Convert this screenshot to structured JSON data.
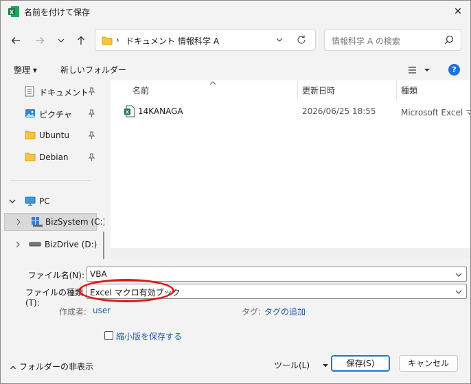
{
  "window": {
    "title": "名前を付けて保存",
    "close_glyph": "✕"
  },
  "address": {
    "crumbs": [
      "ドキュメント",
      "情報科学 A"
    ],
    "separator": "›",
    "search_placeholder": "情報科学 A の検索"
  },
  "toolbar": {
    "organize": "整理 ▾",
    "new_folder": "新しいフォルダー",
    "help": "?"
  },
  "nav": {
    "items": [
      {
        "label": "ドキュメント"
      },
      {
        "label": "ピクチャ"
      },
      {
        "label": "Ubuntu"
      },
      {
        "label": "Debian"
      },
      {
        "label": "PC"
      },
      {
        "label": "BizSystem (C:)"
      },
      {
        "label": "BizDrive (D:)"
      }
    ]
  },
  "columns": {
    "name": "名前",
    "date": "更新日時",
    "type": "種類"
  },
  "files": [
    {
      "name": "14KANAGA",
      "date": "2026/06/25 18:55",
      "type": "Microsoft Excel マ"
    }
  ],
  "form": {
    "filename_label": "ファイル名(N):",
    "filename_value": "VBA",
    "filetype_label": "ファイルの種類(T):",
    "filetype_value": "Excel マクロ有効ブック",
    "author_label": "作成者:",
    "author_value": "user",
    "tags_label": "タグ:",
    "tags_value": "タグの追加",
    "thumbnail_label": "縮小版を保存する"
  },
  "footer": {
    "hide_folders": "フォルダーの非表示",
    "tools": "ツール(L)",
    "save": "保存(S)",
    "cancel": "キャンセル"
  },
  "colors": {
    "accent": "#1e73d6",
    "highlight": "#e01818",
    "excel_green": "#1d7044"
  }
}
